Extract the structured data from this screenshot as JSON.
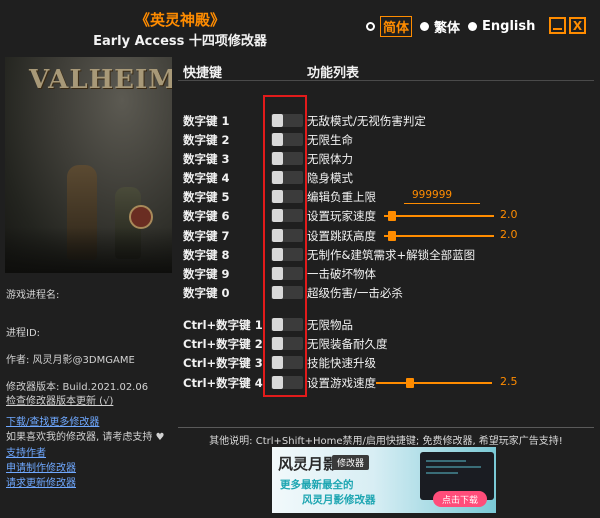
{
  "header": {
    "game_title": "《英灵神殿》",
    "subtitle": "Early Access 十四项修改器"
  },
  "languages": [
    {
      "label": "简体",
      "selected": true
    },
    {
      "label": "繁体",
      "selected": false
    },
    {
      "label": "English",
      "selected": false
    }
  ],
  "window_controls": {
    "minimize": "_",
    "close": "X"
  },
  "cover": {
    "logo_text": "VALHEIM"
  },
  "left_info": {
    "progress_label": "游戏进程名:",
    "pid_label": "进程ID:",
    "author": "作者: 风灵月影@3DMGAME",
    "version": "修改器版本: Build.2021.02.06",
    "check_update": "检查修改器版本更新 (√)",
    "links": [
      "下载/查找更多修改器",
      "支持作者",
      "申请制作修改器",
      "请求更新修改器"
    ],
    "support_text": "如果喜欢我的修改器, 请考虑支持 ♥"
  },
  "columns": {
    "hotkey": "快捷键",
    "function": "功能列表"
  },
  "rows": [
    {
      "hotkey": "数字键 1",
      "function": "无敌模式/无视伤害判定"
    },
    {
      "hotkey": "数字键 2",
      "function": "无限生命"
    },
    {
      "hotkey": "数字键 3",
      "function": "无限体力"
    },
    {
      "hotkey": "数字键 4",
      "function": "隐身模式"
    },
    {
      "hotkey": "数字键 5",
      "function": "编辑负重上限",
      "input_value": "999999"
    },
    {
      "hotkey": "数字键 6",
      "function": "设置玩家速度",
      "slider_value": "2.0"
    },
    {
      "hotkey": "数字键 7",
      "function": "设置跳跃高度",
      "slider_value": "2.0"
    },
    {
      "hotkey": "数字键 8",
      "function": "无制作&建筑需求+解锁全部蓝图"
    },
    {
      "hotkey": "数字键 9",
      "function": "一击破坏物体"
    },
    {
      "hotkey": "数字键 0",
      "function": "超级伤害/一击必杀"
    },
    {
      "hotkey": "Ctrl+数字键 1",
      "function": "无限物品"
    },
    {
      "hotkey": "Ctrl+数字键 2",
      "function": "无限装备耐久度"
    },
    {
      "hotkey": "Ctrl+数字键 3",
      "function": "技能快速升级"
    },
    {
      "hotkey": "Ctrl+数字键 4",
      "function": "设置游戏速度",
      "slider_value": "2.5"
    }
  ],
  "footer_note": "其他说明: Ctrl+Shift+Home禁用/启用快捷键; 免费修改器, 希望玩家广告支持!",
  "banner": {
    "brand": "风灵月影",
    "tag": "修改器",
    "line1": "更多最新最全的",
    "line2": "风灵月影修改器",
    "button": "点击下载"
  },
  "colors": {
    "accent": "#ff8c00",
    "highlight_box": "#e21b1b",
    "link": "#6fa8ff",
    "background": "#1f1f1f"
  }
}
